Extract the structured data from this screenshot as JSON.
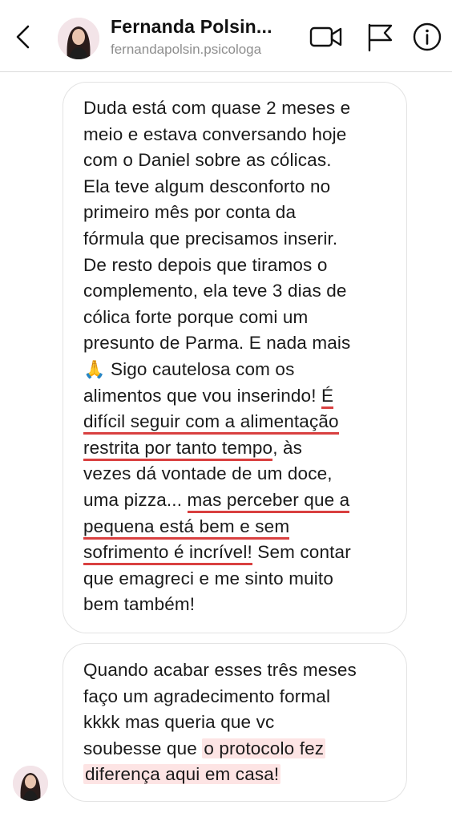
{
  "header": {
    "contact_name": "Fernanda Polsin...",
    "username": "fernandapolsin.psicologa",
    "icons": [
      "back-chevron-icon",
      "video-call-icon",
      "flag-icon",
      "info-icon"
    ]
  },
  "messages": [
    {
      "lines": [
        [
          {
            "t": "Duda está com quase 2 meses e"
          }
        ],
        [
          {
            "t": "meio e estava conversando hoje"
          }
        ],
        [
          {
            "t": "com o Daniel sobre as cólicas."
          }
        ],
        [
          {
            "t": "Ela teve algum desconforto no"
          }
        ],
        [
          {
            "t": "primeiro mês por conta da"
          }
        ],
        [
          {
            "t": "fórmula que precisamos inserir."
          }
        ],
        [
          {
            "t": "De resto depois que tiramos o"
          }
        ],
        [
          {
            "t": "complemento, ela teve 3 dias de"
          }
        ],
        [
          {
            "t": "cólica forte porque comi um"
          }
        ],
        [
          {
            "t": "presunto de Parma. E nada mais"
          }
        ],
        [
          {
            "t": "🙏",
            "s": "pray"
          },
          {
            "t": " Sigo cautelosa com os"
          }
        ],
        [
          {
            "t": "alimentos que vou inserindo! "
          },
          {
            "t": "É",
            "s": "ul"
          }
        ],
        [
          {
            "t": "difícil seguir com a alimentação",
            "s": "ul"
          }
        ],
        [
          {
            "t": "restrita por tanto tempo",
            "s": "ul"
          },
          {
            "t": ", às"
          }
        ],
        [
          {
            "t": "vezes dá vontade de um doce,"
          }
        ],
        [
          {
            "t": "uma pizza... "
          },
          {
            "t": "mas perceber que a",
            "s": "ul"
          }
        ],
        [
          {
            "t": "pequena está bem e sem",
            "s": "ul"
          }
        ],
        [
          {
            "t": "sofrimento é incrível!",
            "s": "ul"
          },
          {
            "t": " Sem contar"
          }
        ],
        [
          {
            "t": "que emagreci e me sinto muito"
          }
        ],
        [
          {
            "t": "bem também!"
          }
        ]
      ]
    },
    {
      "lines": [
        [
          {
            "t": "Quando acabar esses três meses"
          }
        ],
        [
          {
            "t": "faço um agradecimento formal"
          }
        ],
        [
          {
            "t": "kkkk mas queria que vc"
          }
        ],
        [
          {
            "t": "soubesse que "
          },
          {
            "t": "o protocolo fez",
            "s": "hl"
          }
        ],
        [
          {
            "t": "diferença aqui em casa!",
            "s": "hl"
          }
        ]
      ]
    }
  ],
  "colors": {
    "underline": "#d94040",
    "highlight": "#fde4e4",
    "bubble_border": "#e3e3e3",
    "username": "#8e8e8e"
  }
}
